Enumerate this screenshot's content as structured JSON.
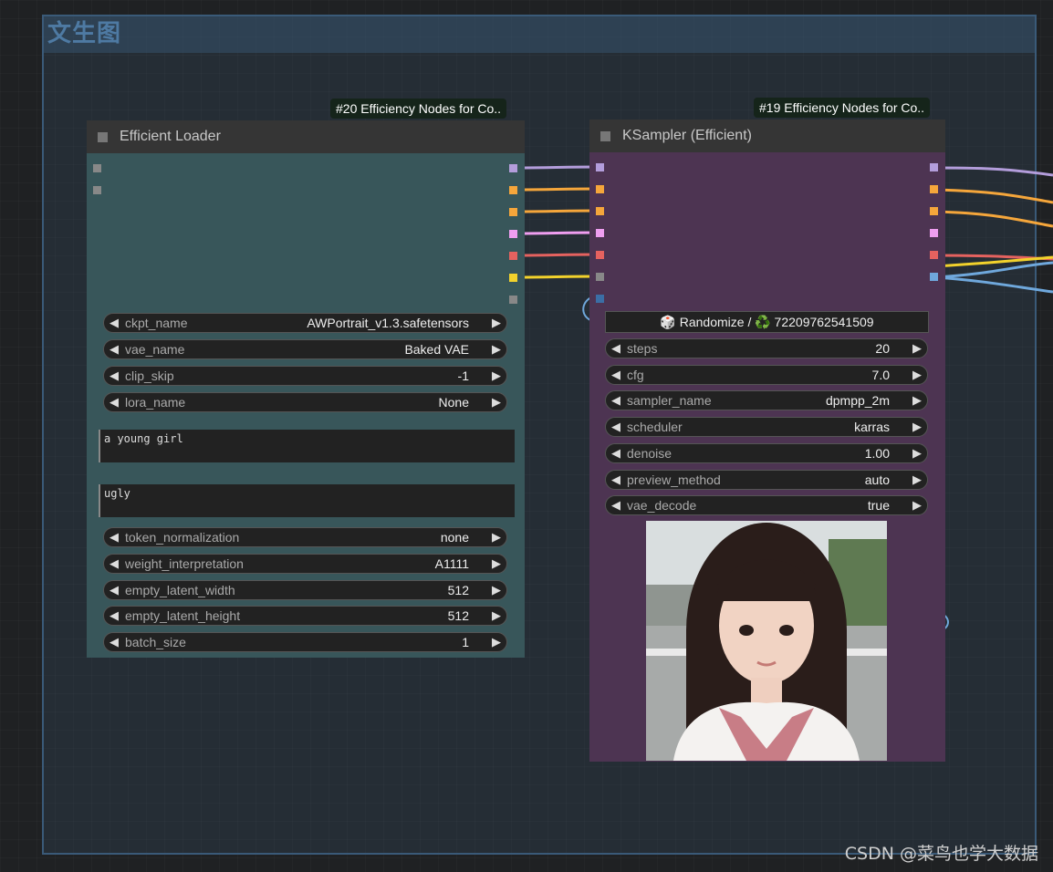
{
  "group": {
    "title": "文生图"
  },
  "loader": {
    "badge": "#20 Efficiency Nodes for Co..",
    "title": "Efficient Loader",
    "widgets": [
      {
        "label": "ckpt_name",
        "value": "AWPortrait_v1.3.safetensors"
      },
      {
        "label": "vae_name",
        "value": "Baked VAE"
      },
      {
        "label": "clip_skip",
        "value": "-1"
      },
      {
        "label": "lora_name",
        "value": "None"
      }
    ],
    "positive_prompt": "a young girl",
    "negative_prompt": "ugly",
    "widgets2": [
      {
        "label": "token_normalization",
        "value": "none"
      },
      {
        "label": "weight_interpretation",
        "value": "A1111"
      },
      {
        "label": "empty_latent_width",
        "value": "512"
      },
      {
        "label": "empty_latent_height",
        "value": "512"
      },
      {
        "label": "batch_size",
        "value": "1"
      }
    ]
  },
  "sampler": {
    "badge": "#19 Efficiency Nodes for Co..",
    "title": "KSampler (Efficient)",
    "seed_button": "🎲 Randomize / ♻️ 72209762541509",
    "widgets": [
      {
        "label": "steps",
        "value": "20"
      },
      {
        "label": "cfg",
        "value": "7.0"
      },
      {
        "label": "sampler_name",
        "value": "dpmpp_2m"
      },
      {
        "label": "scheduler",
        "value": "karras"
      },
      {
        "label": "denoise",
        "value": "1.00"
      },
      {
        "label": "preview_method",
        "value": "auto"
      },
      {
        "label": "vae_decode",
        "value": "true"
      }
    ]
  },
  "colors": {
    "loader_body": "#38565a",
    "sampler_body": "#4d3452",
    "model": "#b39ddb",
    "orange": "#f5a63b",
    "pink": "#ef9ef0",
    "red": "#e5625f",
    "yellow": "#f2d22c",
    "blue": "#6fa8dc",
    "gray": "#888888"
  },
  "watermark": "CSDN @菜鸟也学大数据"
}
